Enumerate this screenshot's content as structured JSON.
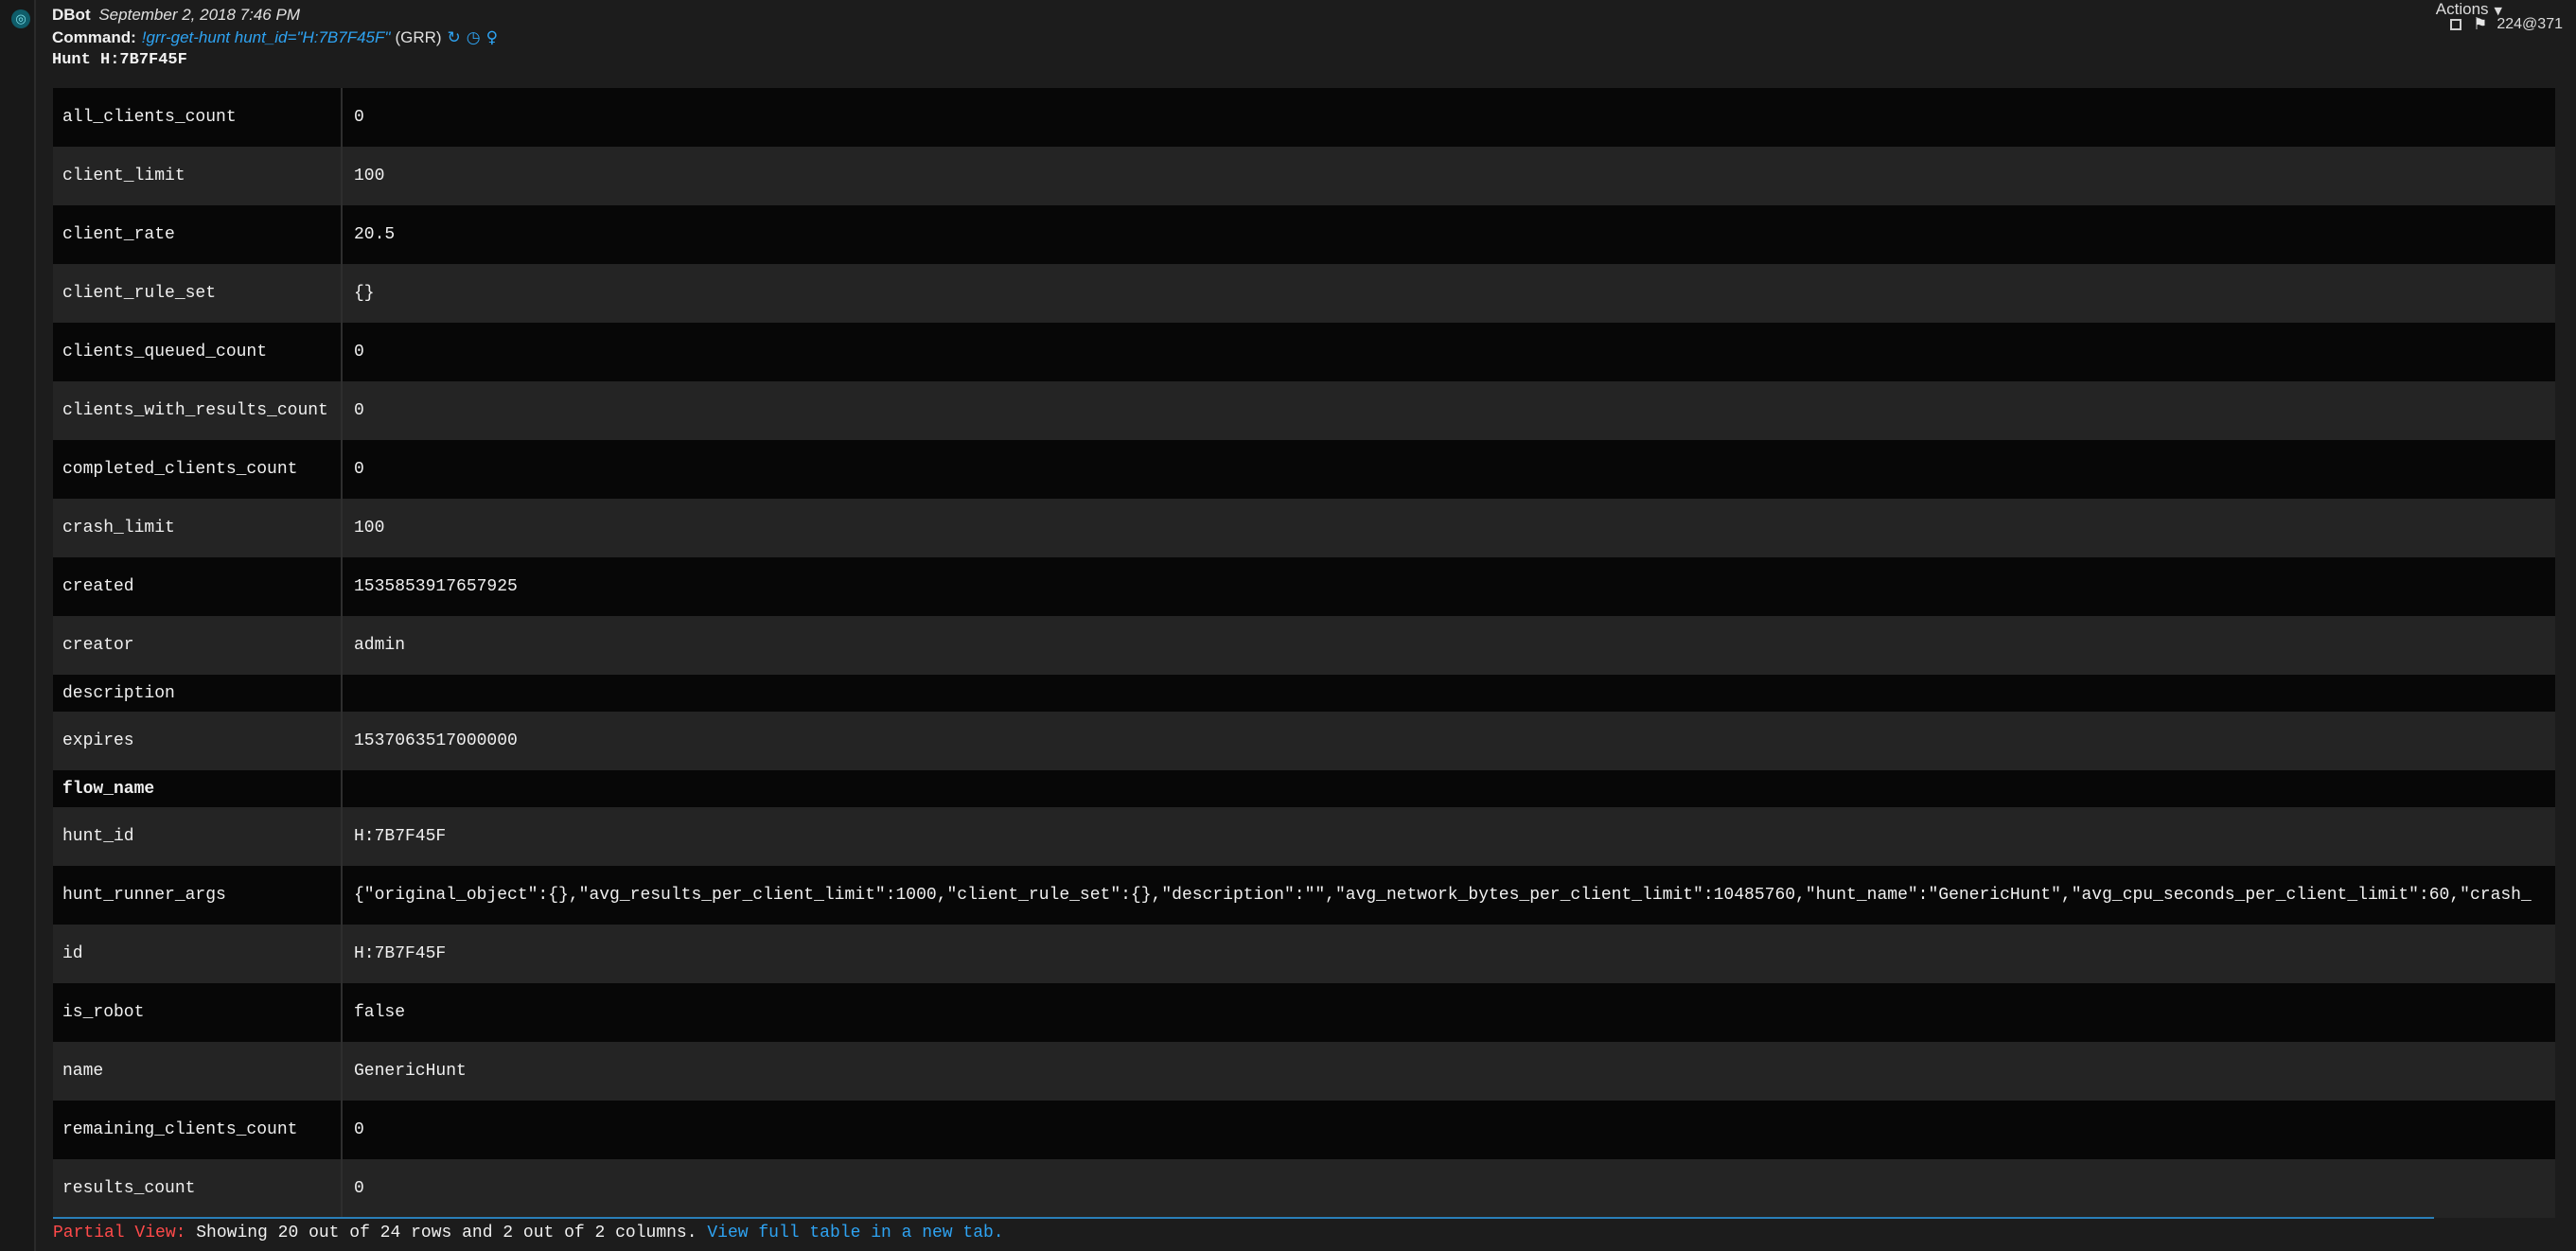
{
  "entry": {
    "author": "DBot",
    "date": "September 2, 2018 7:46 PM",
    "command_label": "Command:",
    "command": "!grr-get-hunt hunt_id=\"H:7B7F45F\"",
    "integration": "(GRR)",
    "title": "Hunt H:7B7F45F",
    "actions_label": "Actions",
    "entry_id": "224@371",
    "icons": [
      "refresh-icon",
      "clock-icon",
      "lightbulb-icon",
      "checkbox-icon",
      "flag-icon"
    ]
  },
  "table": {
    "rows": [
      {
        "key": "all_clients_count",
        "value": "0"
      },
      {
        "key": "client_limit",
        "value": "100"
      },
      {
        "key": "client_rate",
        "value": "20.5"
      },
      {
        "key": "client_rule_set",
        "value": "{}"
      },
      {
        "key": "clients_queued_count",
        "value": "0"
      },
      {
        "key": "clients_with_results_count",
        "value": "0"
      },
      {
        "key": "completed_clients_count",
        "value": "0"
      },
      {
        "key": "crash_limit",
        "value": "100"
      },
      {
        "key": "created",
        "value": "1535853917657925"
      },
      {
        "key": "creator",
        "value": "admin"
      },
      {
        "key": "description",
        "value": ""
      },
      {
        "key": "expires",
        "value": "1537063517000000"
      },
      {
        "key": "flow_name",
        "value": ""
      },
      {
        "key": "hunt_id",
        "value": "H:7B7F45F"
      },
      {
        "key": "hunt_runner_args",
        "value": "{\"original_object\":{},\"avg_results_per_client_limit\":1000,\"client_rule_set\":{},\"description\":\"\",\"avg_network_bytes_per_client_limit\":10485760,\"hunt_name\":\"GenericHunt\",\"avg_cpu_seconds_per_client_limit\":60,\"crash_"
      },
      {
        "key": "id",
        "value": "H:7B7F45F"
      },
      {
        "key": "is_robot",
        "value": "false"
      },
      {
        "key": "name",
        "value": "GenericHunt"
      },
      {
        "key": "remaining_clients_count",
        "value": "0"
      },
      {
        "key": "results_count",
        "value": "0"
      }
    ]
  },
  "footer": {
    "partial_label": "Partial View:",
    "summary": "Showing 20 out of 24 rows and 2 out of 2 columns.",
    "link": "View full table in a new tab."
  },
  "colors": {
    "link": "#2ea3f2",
    "warning": "#ff4a4a",
    "row_dark": "#070707",
    "row_light": "#242424"
  }
}
